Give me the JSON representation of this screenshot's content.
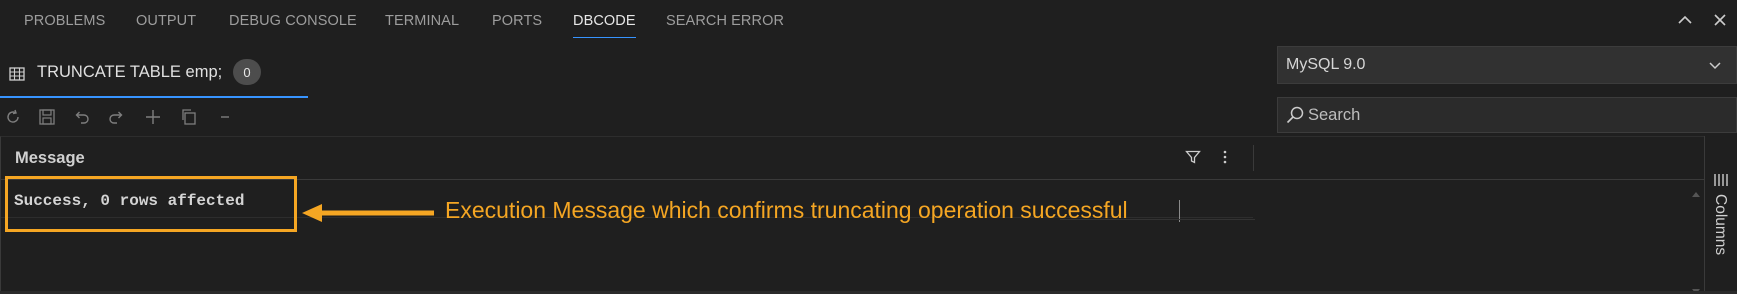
{
  "panel_tabs": [
    {
      "label": "PROBLEMS"
    },
    {
      "label": "OUTPUT"
    },
    {
      "label": "DEBUG CONSOLE"
    },
    {
      "label": "TERMINAL"
    },
    {
      "label": "PORTS"
    },
    {
      "label": "DBCODE",
      "active": true
    },
    {
      "label": "SEARCH ERROR"
    }
  ],
  "panel_controls": {
    "maximize_icon": "chevron-up-icon",
    "close_icon": "close-icon"
  },
  "query_tab": {
    "icon": "table-grid-icon",
    "label": "TRUNCATE TABLE emp;",
    "badge": "0"
  },
  "connection": {
    "selected": "MySQL 9.0",
    "icon": "chevron-down-icon"
  },
  "toolbar": {
    "icons": [
      "refresh-icon",
      "save-icon",
      "undo-icon",
      "redo-icon",
      "add-row-icon",
      "copy-icon",
      "remove-row-icon"
    ]
  },
  "search": {
    "placeholder": "Search",
    "icon": "search-icon"
  },
  "results": {
    "columns": [
      "Message"
    ],
    "rows": [
      [
        "Success, 0 rows affected"
      ]
    ]
  },
  "side_panel": {
    "label": "Columns",
    "icon": "columns-icon"
  },
  "annotation": {
    "text": "Execution Message which confirms truncating operation successful",
    "color": "#f5a623"
  },
  "colors": {
    "accent": "#3794ff",
    "background": "#1f1f1f",
    "annotation": "#f5a623"
  }
}
